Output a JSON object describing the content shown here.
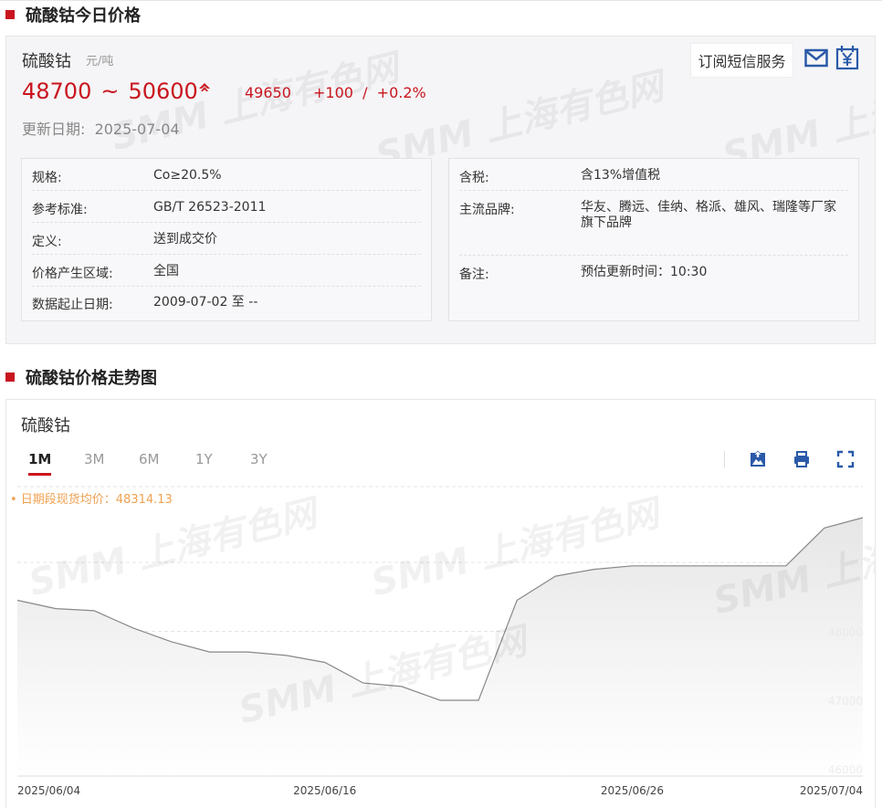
{
  "section1": {
    "title": "硫酸钴今日价格"
  },
  "section2": {
    "title": "硫酸钴价格走势图"
  },
  "watermark": "SMM 上海有色网",
  "price": {
    "product": "硫酸钴",
    "unit": "元/吨",
    "low": "48700",
    "tilde": "~",
    "high": "50600",
    "avg": "49650",
    "change": "+100  /  +0.2%",
    "update_date": "更新日期:  2025-07-04",
    "subscribe_label": "订阅短信服务",
    "up_color": "#c9151e"
  },
  "spec_left": [
    {
      "key": "规格:",
      "value": "Co≥20.5%"
    },
    {
      "key": "参考标准:",
      "value": "GB/T 26523-2011"
    },
    {
      "key": "定义:",
      "value": "送到成交价"
    },
    {
      "key": "价格产生区域:",
      "value": "全国"
    },
    {
      "key": "数据起止日期:",
      "value": "2009-07-02 至 --"
    }
  ],
  "spec_right": [
    {
      "key": "含税:",
      "value": "含13%增值税"
    },
    {
      "key": "主流品牌:",
      "value": "华友、腾远、佳纳、格派、雄风、瑞隆等厂家旗下品牌"
    },
    {
      "key": "备注:",
      "value": "预估更新时间：10:30"
    }
  ],
  "chart": {
    "name": "硫酸钴",
    "tabs": [
      "1M",
      "3M",
      "6M",
      "1Y",
      "3Y"
    ],
    "active_tab": "1M",
    "avg_label": "• 日期段现货均价：48314.13",
    "icons": [
      "download-image-icon",
      "print-icon",
      "fullscreen-icon"
    ]
  },
  "chart_data": {
    "type": "area",
    "x": [
      "2025-06-04",
      "2025-06-05",
      "2025-06-06",
      "2025-06-09",
      "2025-06-10",
      "2025-06-11",
      "2025-06-12",
      "2025-06-13",
      "2025-06-16",
      "2025-06-17",
      "2025-06-18",
      "2025-06-19",
      "2025-06-20",
      "2025-06-23",
      "2025-06-24",
      "2025-06-25",
      "2025-06-26",
      "2025-06-27",
      "2025-06-30",
      "2025-07-01",
      "2025-07-02",
      "2025-07-03",
      "2025-07-04"
    ],
    "series": [
      {
        "values": [
          48450,
          48330,
          48300,
          48050,
          47850,
          47700,
          47700,
          47650,
          47550,
          47250,
          47200,
          47000,
          47000,
          48450,
          48800,
          48900,
          48950,
          48950,
          48950,
          48950,
          48950,
          49500,
          49650
        ]
      }
    ],
    "x_tick_labels": [
      "2025/06/04",
      "2025/06/16",
      "2025/06/26",
      "2025/07/04"
    ],
    "x_tick_index": [
      0,
      8,
      16,
      22
    ],
    "y_ticks": [
      46000,
      47000,
      48000,
      49000
    ],
    "ylim": [
      45900,
      50100
    ],
    "y_axis_position": "right",
    "grid": true,
    "line_color": "#888888",
    "fill_color": "#e6e6e6"
  }
}
